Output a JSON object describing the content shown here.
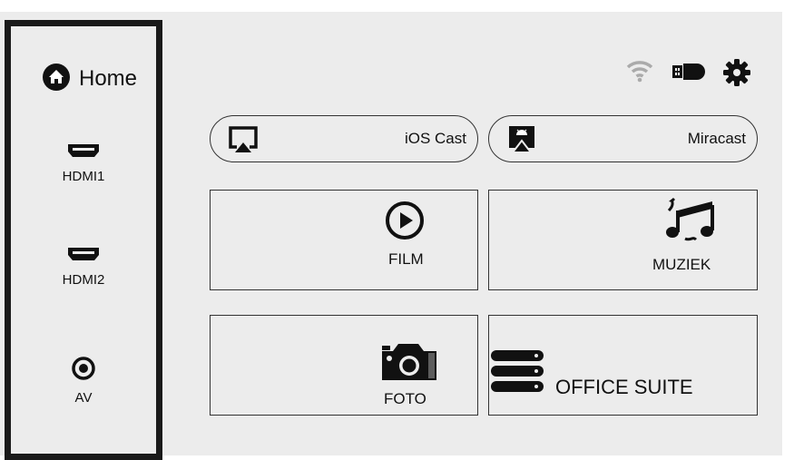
{
  "sidebar": {
    "home_label": "Home",
    "items": [
      {
        "label": "HDMI1",
        "icon": "hdmi-icon"
      },
      {
        "label": "HDMI2",
        "icon": "hdmi-icon"
      },
      {
        "label": "AV",
        "icon": "av-jack-icon"
      }
    ]
  },
  "status_bar": {
    "icons": [
      "wifi-icon",
      "usb-drive-icon",
      "settings-icon"
    ]
  },
  "cast": [
    {
      "label": "iOS Cast",
      "icon": "airplay-icon"
    },
    {
      "label": "Miracast",
      "icon": "miracast-icon"
    }
  ],
  "tiles": [
    {
      "label": "FILM",
      "icon": "play-icon"
    },
    {
      "label": "MUZIEK",
      "icon": "music-icon"
    },
    {
      "label": "FOTO",
      "icon": "camera-icon"
    },
    {
      "label": "OFFICE SUITE",
      "icon": "office-suite-icon"
    }
  ]
}
